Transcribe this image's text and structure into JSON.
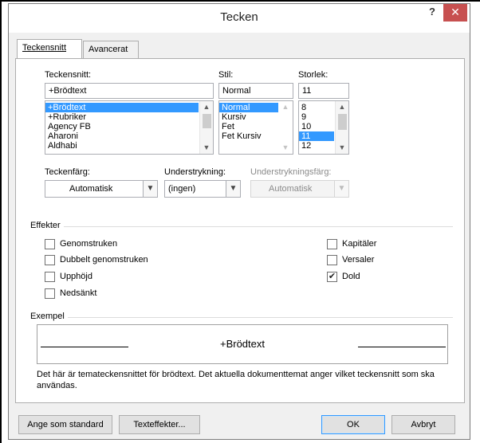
{
  "window": {
    "title": "Tecken",
    "help_label": "?",
    "close_label": "✕"
  },
  "tabs": [
    {
      "label": "Teckensnitt",
      "active": true
    },
    {
      "label": "Avancerat",
      "active": false
    }
  ],
  "font": {
    "label": "Teckensnitt:",
    "value": "+Brödtext",
    "items": [
      "+Brödtext",
      "+Rubriker",
      "Agency FB",
      "Aharoni",
      "Aldhabi"
    ],
    "selected_index": 0
  },
  "style": {
    "label": "Stil:",
    "value": "Normal",
    "items": [
      "Normal",
      "Kursiv",
      "Fet",
      "Fet Kursiv"
    ],
    "selected_index": 0
  },
  "size": {
    "label": "Storlek:",
    "value": "11",
    "items": [
      "8",
      "9",
      "10",
      "11",
      "12"
    ],
    "selected_index": 3
  },
  "font_color": {
    "label": "Teckenfärg:",
    "value": "Automatisk"
  },
  "underline": {
    "label": "Understrykning:",
    "value": "(ingen)"
  },
  "underline_color": {
    "label": "Understrykningsfärg:",
    "value": "Automatisk",
    "disabled": true
  },
  "effects": {
    "title": "Effekter",
    "left": [
      {
        "label": "Genomstruken",
        "checked": false
      },
      {
        "label": "Dubbelt genomstruken",
        "checked": false
      },
      {
        "label": "Upphöjd",
        "checked": false
      },
      {
        "label": "Nedsänkt",
        "checked": false
      }
    ],
    "right": [
      {
        "label": "Kapitäler",
        "checked": false
      },
      {
        "label": "Versaler",
        "checked": false
      },
      {
        "label": "Dold",
        "checked": true
      }
    ]
  },
  "preview": {
    "title": "Exempel",
    "text": "+Brödtext",
    "description": "Det här är temateckensnittet för brödtext. Det aktuella dokumenttemat anger vilket teckensnitt som ska användas."
  },
  "buttons": {
    "set_default": "Ange som standard",
    "text_effects": "Texteffekter...",
    "ok": "OK",
    "cancel": "Avbryt"
  }
}
